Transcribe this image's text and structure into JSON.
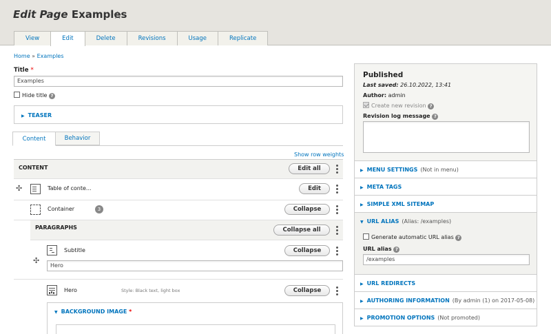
{
  "page": {
    "title_prefix": "Edit Page",
    "title_name": "Examples"
  },
  "tabs": [
    "View",
    "Edit",
    "Delete",
    "Revisions",
    "Usage",
    "Replicate"
  ],
  "breadcrumb": {
    "home": "Home",
    "sep": "»",
    "current": "Examples"
  },
  "title_field": {
    "label": "Title",
    "required": "*",
    "value": "Examples"
  },
  "hide_title": {
    "label": "Hide title"
  },
  "teaser": {
    "label": "TEASER"
  },
  "content_tabs": [
    "Content",
    "Behavior"
  ],
  "show_row_weights": "Show row weights",
  "content_section": {
    "heading": "CONTENT",
    "edit_all": "Edit all",
    "rows": [
      {
        "label": "Table of conte...",
        "button": "Edit"
      },
      {
        "label": "Container",
        "badge": "3",
        "button": "Collapse"
      }
    ],
    "paragraphs": {
      "heading": "PARAGRAPHS",
      "collapse_all": "Collapse all",
      "subtitle": {
        "label": "Subtitle",
        "button": "Collapse",
        "value": "Hero"
      },
      "hero": {
        "label": "Hero",
        "summary": "Style: Black text, light box",
        "button": "Collapse"
      },
      "background_image": {
        "label": "BACKGROUND IMAGE",
        "required": "*"
      }
    }
  },
  "sidebar": {
    "status": "Published",
    "last_saved_label": "Last saved:",
    "last_saved_value": "26.10.2022, 13:41",
    "author_label": "Author:",
    "author_value": "admin",
    "create_revision": "Create new revision",
    "revision_log_label": "Revision log message",
    "sections": [
      {
        "label": "MENU SETTINGS",
        "note": "(Not in menu)"
      },
      {
        "label": "META TAGS",
        "note": ""
      },
      {
        "label": "SIMPLE XML SITEMAP",
        "note": ""
      },
      {
        "label": "URL ALIAS",
        "note": "(Alias: /examples)"
      },
      {
        "label": "URL REDIRECTS",
        "note": ""
      },
      {
        "label": "AUTHORING INFORMATION",
        "note": "(By admin (1) on 2017-05-08)"
      },
      {
        "label": "PROMOTION OPTIONS",
        "note": "(Not promoted)"
      }
    ],
    "url_alias": {
      "generate_label": "Generate automatic URL alias",
      "field_label": "URL alias",
      "value": "/examples"
    }
  }
}
